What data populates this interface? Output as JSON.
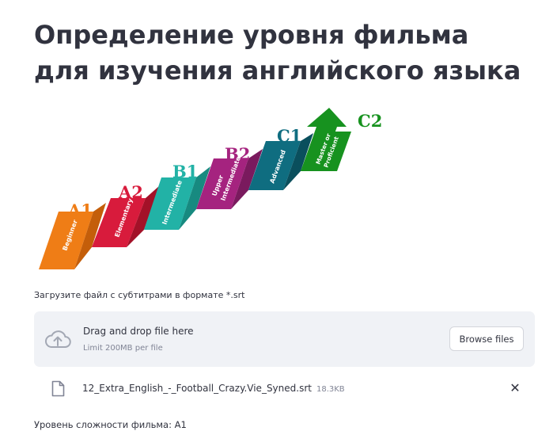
{
  "page": {
    "title": "Определение уровня фильма для изучения английского языка"
  },
  "hero": {
    "levels": [
      {
        "code": "A1",
        "name": "Beginner",
        "color": "#ef7d16"
      },
      {
        "code": "A2",
        "name": "Elementary",
        "color": "#d81b3c"
      },
      {
        "code": "B1",
        "name": "Intermediate",
        "color": "#22b2a6"
      },
      {
        "code": "B2",
        "name_line1": "Upper",
        "name_line2": "Intermediate",
        "color": "#a5237f"
      },
      {
        "code": "C1",
        "name": "Advanced",
        "color": "#0f6d80"
      },
      {
        "code": "C2",
        "name_line1": "Master or",
        "name_line2": "Proficient",
        "color": "#17921f"
      }
    ]
  },
  "uploader": {
    "label": "Загрузите файл с субтитрами в формате *.srt",
    "drop_title": "Drag and drop file here",
    "drop_limit": "Limit 200MB per file",
    "browse_label": "Browse files",
    "upload_icon": "cloud-upload-icon"
  },
  "uploaded_file": {
    "name": "12_Extra_English_-_Football_Crazy.Vie_Syned.srt",
    "size": "18.3KB",
    "file_icon": "file-icon",
    "remove_glyph": "✕"
  },
  "result": {
    "text": "Уровень сложности фильма: A1"
  }
}
